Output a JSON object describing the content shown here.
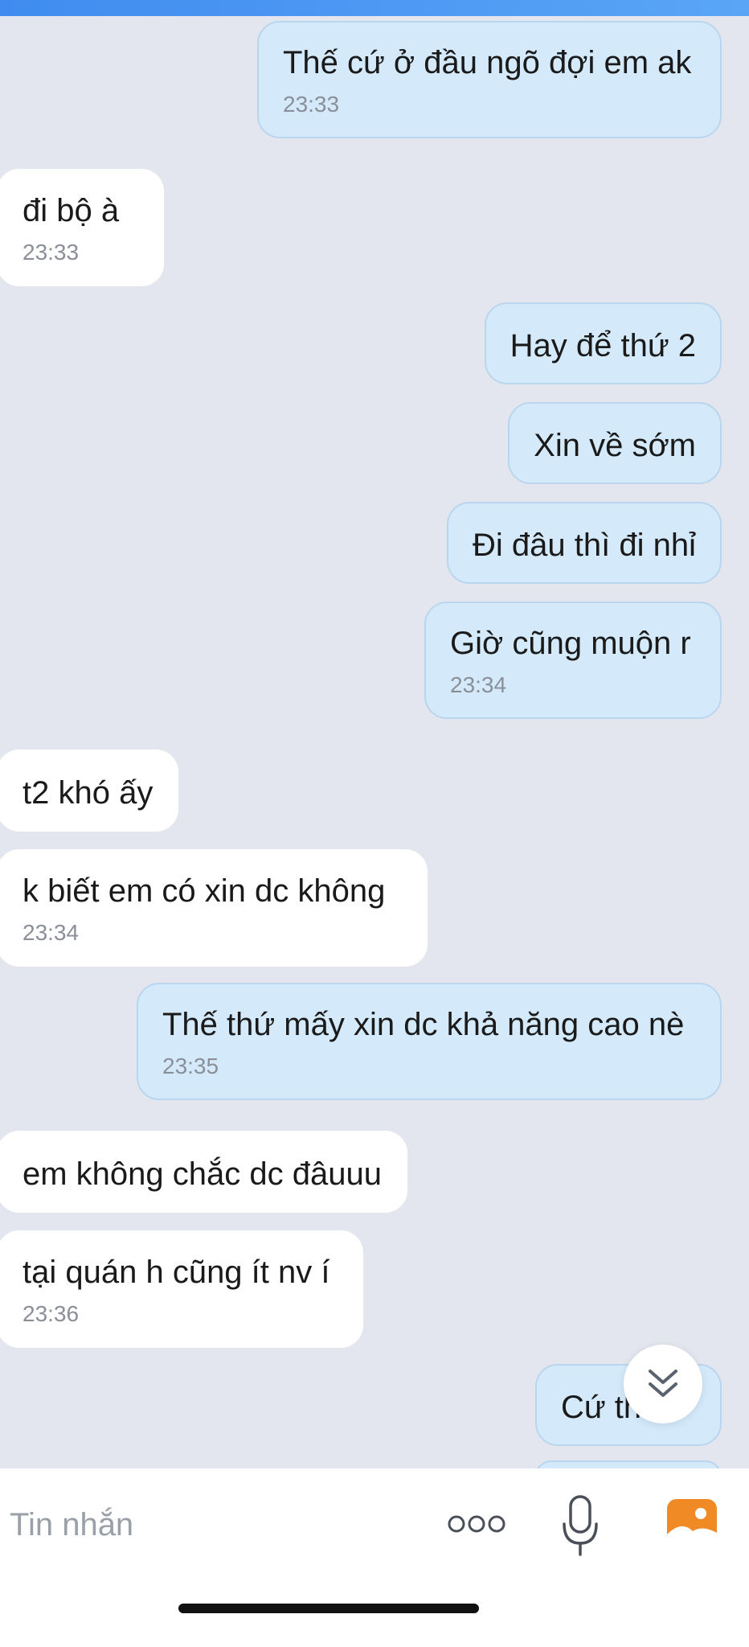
{
  "messages": [
    {
      "direction": "out",
      "text": "Thế cứ ở đầu ngõ đợi em ak",
      "time": "23:33"
    },
    {
      "direction": "in",
      "text": "đi bộ à",
      "time": "23:33"
    },
    {
      "direction": "out",
      "text": "Hay để thứ 2"
    },
    {
      "direction": "out",
      "text": "Xin về sớm"
    },
    {
      "direction": "out",
      "text": "Đi đâu thì đi nhỉ"
    },
    {
      "direction": "out",
      "text": "Giờ cũng muộn r",
      "time": "23:34"
    },
    {
      "direction": "in",
      "text": "t2 khó ấy"
    },
    {
      "direction": "in",
      "text": "k biết em có xin dc không",
      "time": "23:34"
    },
    {
      "direction": "out",
      "text": "Thế thứ mấy xin dc khả năng cao nè",
      "time": "23:35"
    },
    {
      "direction": "in",
      "text": "em không chắc dc đâuuu"
    },
    {
      "direction": "in",
      "text": "tại quán h cũng ít nv í",
      "time": "23:36"
    },
    {
      "direction": "out",
      "text": "Cứ th"
    }
  ],
  "composer": {
    "placeholder": "Tin nhắn"
  },
  "icons": {
    "scroll_down": "chevron-double-down-icon",
    "more": "more-dots-icon",
    "mic": "microphone-icon",
    "gallery": "image-gallery-icon"
  },
  "colors": {
    "outgoing_bubble": "#d4eafb",
    "incoming_bubble": "#ffffff",
    "chat_background": "#e3e6ee",
    "gallery_icon": "#f08a24"
  }
}
